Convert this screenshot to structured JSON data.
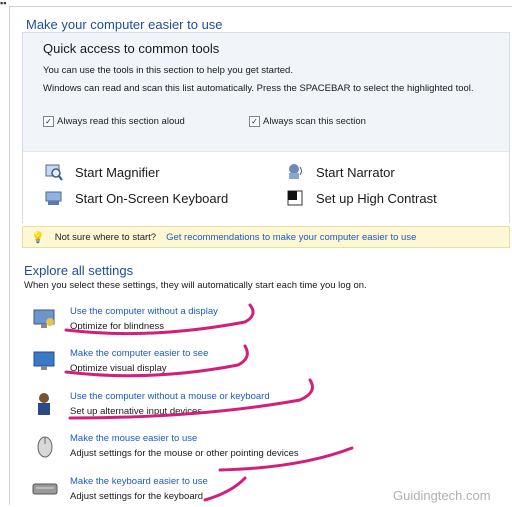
{
  "window": {
    "title": "Make your computer easier to use"
  },
  "quick_access": {
    "title": "Quick access to common tools",
    "desc": "You can use the tools in this section to help you get started.",
    "desc2": "Windows can read and scan this list automatically.  Press the SPACEBAR to select the highlighted tool.",
    "checkbox_read": {
      "label": "Always read this section aloud",
      "checked": true
    },
    "checkbox_scan": {
      "label": "Always scan this section",
      "checked": true
    },
    "tools": [
      {
        "label": "Start Magnifier",
        "icon": "magnifier-icon"
      },
      {
        "label": "Start Narrator",
        "icon": "narrator-icon"
      },
      {
        "label": "Start On-Screen Keyboard",
        "icon": "keyboard-icon"
      },
      {
        "label": "Set up High Contrast",
        "icon": "contrast-icon"
      }
    ]
  },
  "hint": {
    "prefix": "Not sure where to start?",
    "link": "Get recommendations to make your computer easier to use"
  },
  "explore": {
    "title": "Explore all settings",
    "desc": "When you select these settings, they will automatically start each time you log on.",
    "items": [
      {
        "link": "Use the computer without a display",
        "sub": "Optimize for blindness",
        "icon": "monitor-icon"
      },
      {
        "link": "Make the computer easier to see",
        "sub": "Optimize visual display",
        "icon": "display-icon"
      },
      {
        "link": "Use the computer without a mouse or keyboard",
        "sub": "Set up alternative input devices",
        "icon": "user-icon"
      },
      {
        "link": "Make the mouse easier to use",
        "sub": "Adjust settings for the mouse or other pointing devices",
        "icon": "mouse-icon"
      },
      {
        "link": "Make the keyboard easier to use",
        "sub": "Adjust settings for the keyboard",
        "icon": "keyboard-icon"
      }
    ]
  },
  "watermark": "Guidingtech.com",
  "colors": {
    "link": "#1d5bc0",
    "title": "#1e4e93",
    "scribble": "#d21f7a",
    "hint_bg": "#fdf7d3"
  }
}
